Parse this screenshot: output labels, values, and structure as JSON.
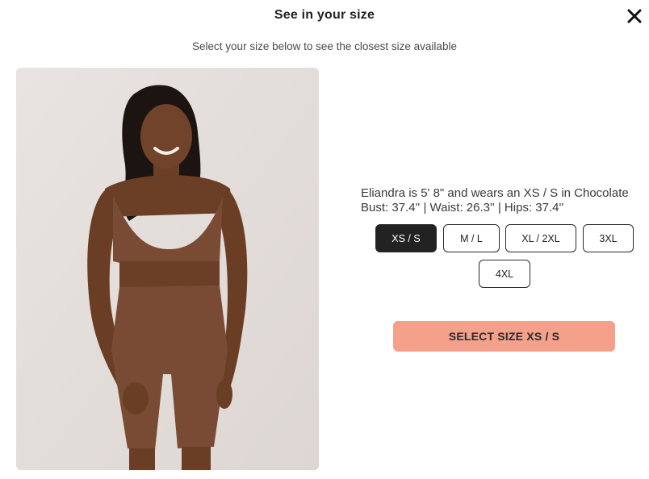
{
  "modal": {
    "title": "See in your size",
    "subtitle": "Select your size below to see the closest size available"
  },
  "model_info": {
    "line1": "Eliandra is 5' 8\" and wears an XS / S in Chocolate",
    "line2": "Bust: 37.4'' | Waist: 26.3'' | Hips: 37.4''"
  },
  "sizes": {
    "selected": "XS / S",
    "options": [
      "XS / S",
      "M / L",
      "XL / 2XL",
      "3XL",
      "4XL"
    ]
  },
  "select_button": {
    "label": "SELECT SIZE XS / S"
  },
  "icons": {
    "close": "close-icon"
  },
  "colors": {
    "selected_bg": "#222222",
    "cta_bg": "#f4a08b",
    "garment": "#7a4b34"
  }
}
